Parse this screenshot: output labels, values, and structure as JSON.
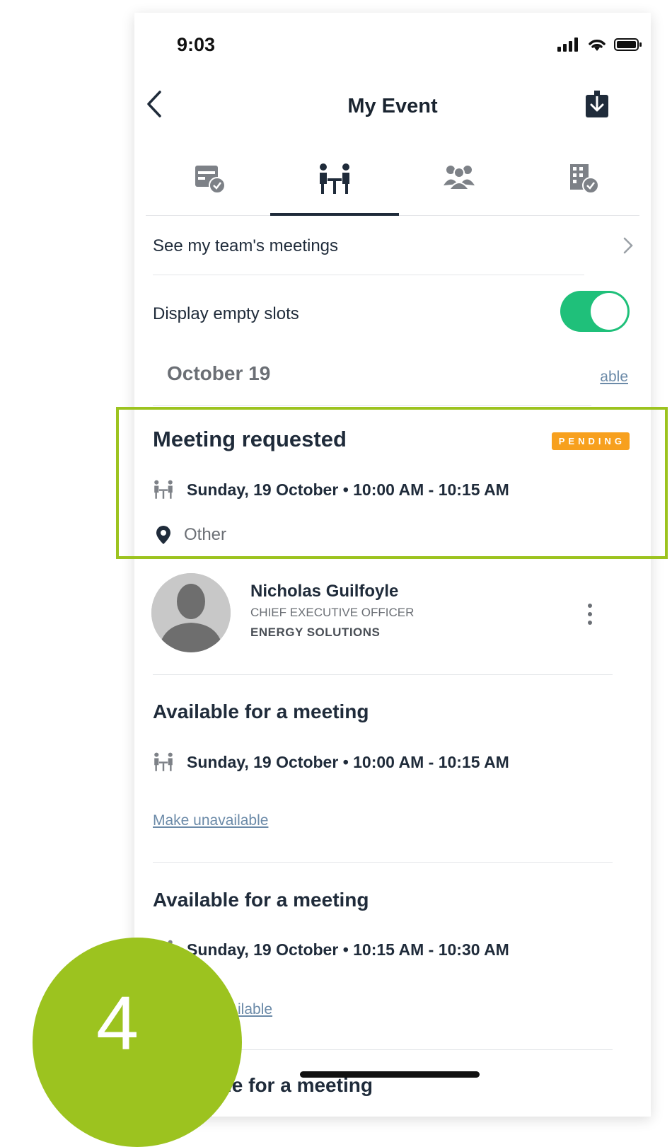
{
  "status_bar": {
    "time": "9:03"
  },
  "header": {
    "title": "My Event"
  },
  "tabs": [
    {
      "icon": "calendar-check-icon"
    },
    {
      "icon": "meeting-table-icon",
      "active": true
    },
    {
      "icon": "people-group-icon"
    },
    {
      "icon": "building-check-icon"
    }
  ],
  "team_meetings": {
    "label": "See my team's meetings"
  },
  "empty_slots": {
    "label": "Display empty slots",
    "enabled": true
  },
  "date_header": {
    "date": "October 19",
    "link_fragment": "able"
  },
  "meeting_requested": {
    "title": "Meeting requested",
    "status": "PENDING",
    "datetime": "Sunday, 19 October • 10:00 AM - 10:15 AM",
    "location": "Other"
  },
  "attendee": {
    "name": "Nicholas Guilfoyle",
    "role": "CHIEF EXECUTIVE OFFICER",
    "company": "ENERGY SOLUTIONS"
  },
  "slots": [
    {
      "title": "Available for a meeting",
      "datetime": "Sunday, 19 October • 10:00 AM - 10:15 AM",
      "action": "Make unavailable"
    },
    {
      "title": "Available for a meeting",
      "datetime": "Sunday, 19 October • 10:15 AM - 10:30 AM",
      "action_fragment": "ilable"
    },
    {
      "title_fragment": "le for a meeting"
    }
  ],
  "step_marker": {
    "number": "4"
  },
  "colors": {
    "toggle_on": "#1fc07a",
    "badge_pending": "#f7a01e",
    "highlight": "#9cc31f",
    "link": "#6b8aa8"
  }
}
